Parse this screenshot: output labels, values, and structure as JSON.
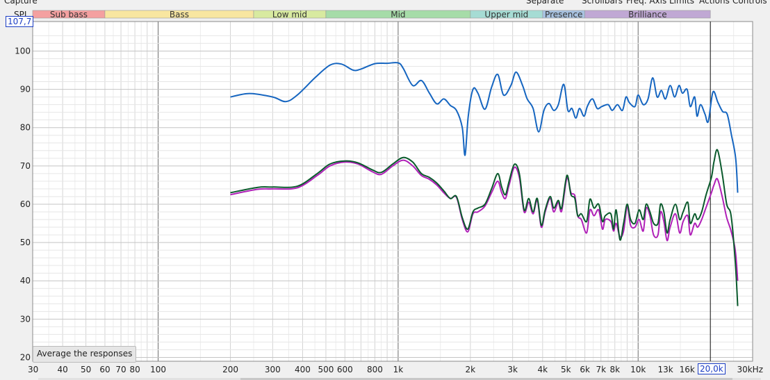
{
  "header": {
    "capture": "Capture",
    "separate": "Separate",
    "menu": [
      "Scrollbars",
      "Freq. Axis",
      "Limits",
      "Actions",
      "Controls"
    ]
  },
  "spl_label": "SPL",
  "readout_y": "107,7",
  "readout_x": "20,0k",
  "average_button": "Average the responses",
  "bands": [
    {
      "label": "Sub bass",
      "from": 30,
      "to": 60,
      "color": "#f4a0a0"
    },
    {
      "label": "Bass",
      "from": 60,
      "to": 250,
      "color": "#f8e6a0"
    },
    {
      "label": "Low mid",
      "from": 250,
      "to": 500,
      "color": "#d8eaa0"
    },
    {
      "label": "Mid",
      "from": 500,
      "to": 2000,
      "color": "#a6dca8"
    },
    {
      "label": "Upper mid",
      "from": 2000,
      "to": 4000,
      "color": "#a6dcd4"
    },
    {
      "label": "Presence",
      "from": 4000,
      "to": 6000,
      "color": "#a8c2e0"
    },
    {
      "label": "Brilliance",
      "from": 6000,
      "to": 20000,
      "color": "#c0a8d4"
    }
  ],
  "chart_data": {
    "type": "line",
    "xlabel": "",
    "ylabel": "SPL",
    "x_scale": "log",
    "xlim": [
      30,
      30000
    ],
    "ylim": [
      19,
      107.7
    ],
    "grid": true,
    "x_tick_labels": [
      {
        "v": 30,
        "t": "30"
      },
      {
        "v": 40,
        "t": "40"
      },
      {
        "v": 50,
        "t": "50"
      },
      {
        "v": 60,
        "t": "60"
      },
      {
        "v": 70,
        "t": "70"
      },
      {
        "v": 80,
        "t": "80"
      },
      {
        "v": 100,
        "t": "100"
      },
      {
        "v": 200,
        "t": "200"
      },
      {
        "v": 300,
        "t": "300"
      },
      {
        "v": 400,
        "t": "400"
      },
      {
        "v": 500,
        "t": "500"
      },
      {
        "v": 600,
        "t": "600"
      },
      {
        "v": 800,
        "t": "800"
      },
      {
        "v": 1000,
        "t": "1k"
      },
      {
        "v": 2000,
        "t": "2k"
      },
      {
        "v": 3000,
        "t": "3k"
      },
      {
        "v": 4000,
        "t": "4k"
      },
      {
        "v": 5000,
        "t": "5k"
      },
      {
        "v": 6000,
        "t": "6k"
      },
      {
        "v": 7000,
        "t": "7k"
      },
      {
        "v": 8000,
        "t": "8k"
      },
      {
        "v": 10000,
        "t": "10k"
      },
      {
        "v": 13000,
        "t": "13k"
      },
      {
        "v": 16000,
        "t": "16k"
      },
      {
        "v": 30000,
        "t": "30kHz"
      }
    ],
    "x_tick_labels_dim": [
      "13k",
      "16k"
    ],
    "y_ticks": [
      20,
      30,
      40,
      50,
      60,
      70,
      80,
      90,
      100
    ],
    "cursor_x": 20000,
    "series": [
      {
        "color": "#1565c0",
        "points": [
          [
            200,
            88
          ],
          [
            240,
            88.9
          ],
          [
            300,
            88
          ],
          [
            340,
            86.8
          ],
          [
            380,
            88.5
          ],
          [
            450,
            93
          ],
          [
            520,
            96.3
          ],
          [
            580,
            96.6
          ],
          [
            650,
            95
          ],
          [
            700,
            95.3
          ],
          [
            800,
            96.7
          ],
          [
            900,
            96.8
          ],
          [
            1000,
            96.9
          ],
          [
            1050,
            95.5
          ],
          [
            1150,
            91
          ],
          [
            1250,
            92.3
          ],
          [
            1350,
            89
          ],
          [
            1450,
            86.2
          ],
          [
            1550,
            87.5
          ],
          [
            1650,
            85.8
          ],
          [
            1750,
            84.5
          ],
          [
            1850,
            80
          ],
          [
            1900,
            72.8
          ],
          [
            1960,
            83
          ],
          [
            2050,
            90
          ],
          [
            2150,
            89
          ],
          [
            2300,
            84.8
          ],
          [
            2450,
            90.5
          ],
          [
            2600,
            93.9
          ],
          [
            2750,
            88.5
          ],
          [
            2950,
            91
          ],
          [
            3100,
            94.5
          ],
          [
            3300,
            91
          ],
          [
            3450,
            87.5
          ],
          [
            3650,
            85
          ],
          [
            3850,
            78.9
          ],
          [
            4050,
            84.5
          ],
          [
            4250,
            86.3
          ],
          [
            4450,
            84.5
          ],
          [
            4650,
            86
          ],
          [
            4900,
            91.3
          ],
          [
            5100,
            84.5
          ],
          [
            5300,
            85
          ],
          [
            5500,
            82.5
          ],
          [
            5700,
            85
          ],
          [
            5950,
            83
          ],
          [
            6150,
            85.6
          ],
          [
            6450,
            87.5
          ],
          [
            6750,
            85
          ],
          [
            7050,
            85.5
          ],
          [
            7500,
            86
          ],
          [
            7800,
            84.5
          ],
          [
            8200,
            86
          ],
          [
            8600,
            84.5
          ],
          [
            8900,
            88
          ],
          [
            9200,
            86.5
          ],
          [
            9700,
            85.5
          ],
          [
            10000,
            88.5
          ],
          [
            10500,
            86
          ],
          [
            11000,
            87.5
          ],
          [
            11500,
            93
          ],
          [
            12000,
            88
          ],
          [
            12500,
            89.7
          ],
          [
            13000,
            87.5
          ],
          [
            13600,
            91
          ],
          [
            14200,
            88
          ],
          [
            14800,
            91
          ],
          [
            15300,
            89
          ],
          [
            16000,
            90
          ],
          [
            16500,
            85.5
          ],
          [
            17200,
            88
          ],
          [
            17600,
            83
          ],
          [
            18200,
            86
          ],
          [
            19000,
            83.5
          ],
          [
            19600,
            81.6
          ],
          [
            20500,
            89.3
          ],
          [
            21500,
            86.6
          ],
          [
            22500,
            84.2
          ],
          [
            23500,
            83.5
          ],
          [
            24500,
            78
          ],
          [
            25500,
            72
          ],
          [
            26000,
            63
          ]
        ]
      },
      {
        "color": "#b020b8",
        "points": [
          [
            200,
            62.5
          ],
          [
            260,
            63.9
          ],
          [
            300,
            64
          ],
          [
            380,
            64.3
          ],
          [
            460,
            67.5
          ],
          [
            520,
            70
          ],
          [
            600,
            71
          ],
          [
            680,
            70.5
          ],
          [
            780,
            68.5
          ],
          [
            850,
            67.8
          ],
          [
            950,
            70
          ],
          [
            1050,
            71.5
          ],
          [
            1150,
            70
          ],
          [
            1250,
            67.5
          ],
          [
            1350,
            66.5
          ],
          [
            1450,
            65
          ],
          [
            1550,
            63
          ],
          [
            1650,
            61.5
          ],
          [
            1750,
            61.8
          ],
          [
            1850,
            56
          ],
          [
            1950,
            52.8
          ],
          [
            2050,
            57.5
          ],
          [
            2150,
            58
          ],
          [
            2300,
            59.5
          ],
          [
            2450,
            63
          ],
          [
            2600,
            66
          ],
          [
            2700,
            63
          ],
          [
            2800,
            61.5
          ],
          [
            2900,
            65
          ],
          [
            3050,
            69.6
          ],
          [
            3200,
            67
          ],
          [
            3350,
            58
          ],
          [
            3500,
            60.5
          ],
          [
            3650,
            57.5
          ],
          [
            3800,
            61
          ],
          [
            3950,
            54
          ],
          [
            4100,
            58
          ],
          [
            4300,
            61.5
          ],
          [
            4450,
            58
          ],
          [
            4650,
            60.5
          ],
          [
            4800,
            58.2
          ],
          [
            5050,
            66.8
          ],
          [
            5250,
            63
          ],
          [
            5450,
            62.2
          ],
          [
            5600,
            57
          ],
          [
            5800,
            56
          ],
          [
            6100,
            52.5
          ],
          [
            6300,
            58.5
          ],
          [
            6550,
            57
          ],
          [
            6850,
            58.5
          ],
          [
            7100,
            53.5
          ],
          [
            7300,
            56
          ],
          [
            7700,
            55.5
          ],
          [
            7900,
            53
          ],
          [
            8100,
            55
          ],
          [
            8400,
            51.5
          ],
          [
            8700,
            53
          ],
          [
            9000,
            59.5
          ],
          [
            9300,
            54.5
          ],
          [
            9700,
            54
          ],
          [
            10100,
            56
          ],
          [
            10500,
            53
          ],
          [
            10800,
            59
          ],
          [
            11200,
            57
          ],
          [
            11600,
            52
          ],
          [
            12100,
            52
          ],
          [
            12400,
            58
          ],
          [
            12800,
            55.5
          ],
          [
            13200,
            50.5
          ],
          [
            13600,
            54
          ],
          [
            14300,
            57.5
          ],
          [
            14900,
            52.5
          ],
          [
            15400,
            55.5
          ],
          [
            16100,
            57
          ],
          [
            16500,
            52
          ],
          [
            17200,
            55
          ],
          [
            17700,
            54
          ],
          [
            18400,
            56
          ],
          [
            19200,
            59.2
          ],
          [
            20200,
            63
          ],
          [
            20700,
            65
          ],
          [
            21400,
            66.6
          ],
          [
            22400,
            62
          ],
          [
            23400,
            56.5
          ],
          [
            24400,
            53
          ],
          [
            25400,
            48
          ],
          [
            26000,
            40
          ]
        ]
      },
      {
        "color": "#0a5a2c",
        "points": [
          [
            200,
            63
          ],
          [
            260,
            64.4
          ],
          [
            300,
            64.5
          ],
          [
            380,
            64.7
          ],
          [
            460,
            68
          ],
          [
            520,
            70.5
          ],
          [
            600,
            71.3
          ],
          [
            680,
            70.8
          ],
          [
            780,
            69
          ],
          [
            850,
            68.3
          ],
          [
            950,
            70.5
          ],
          [
            1050,
            72.2
          ],
          [
            1150,
            71
          ],
          [
            1250,
            68
          ],
          [
            1350,
            67
          ],
          [
            1450,
            65.5
          ],
          [
            1550,
            63.5
          ],
          [
            1650,
            61.5
          ],
          [
            1750,
            62
          ],
          [
            1850,
            56.5
          ],
          [
            1950,
            53.5
          ],
          [
            2050,
            58
          ],
          [
            2150,
            59
          ],
          [
            2300,
            60
          ],
          [
            2450,
            64
          ],
          [
            2600,
            68
          ],
          [
            2700,
            64.5
          ],
          [
            2800,
            62.5
          ],
          [
            2900,
            66
          ],
          [
            3050,
            70.4
          ],
          [
            3200,
            68
          ],
          [
            3350,
            58.5
          ],
          [
            3500,
            61.5
          ],
          [
            3650,
            58
          ],
          [
            3800,
            61.5
          ],
          [
            3950,
            54.5
          ],
          [
            4100,
            58.5
          ],
          [
            4300,
            62
          ],
          [
            4450,
            59
          ],
          [
            4650,
            61
          ],
          [
            4800,
            59
          ],
          [
            5050,
            67.5
          ],
          [
            5250,
            62.5
          ],
          [
            5450,
            61.5
          ],
          [
            5600,
            57
          ],
          [
            5800,
            57.5
          ],
          [
            6100,
            55.5
          ],
          [
            6300,
            61.3
          ],
          [
            6550,
            59
          ],
          [
            6850,
            60
          ],
          [
            7100,
            55.5
          ],
          [
            7300,
            57
          ],
          [
            7700,
            57.5
          ],
          [
            7900,
            53.5
          ],
          [
            8100,
            58.5
          ],
          [
            8400,
            50.7
          ],
          [
            8700,
            55
          ],
          [
            9000,
            60
          ],
          [
            9300,
            56
          ],
          [
            9700,
            55
          ],
          [
            10100,
            58.5
          ],
          [
            10500,
            56
          ],
          [
            10800,
            60
          ],
          [
            11200,
            58
          ],
          [
            11600,
            55
          ],
          [
            12100,
            55
          ],
          [
            12400,
            60
          ],
          [
            12800,
            58
          ],
          [
            13200,
            52.5
          ],
          [
            13600,
            56
          ],
          [
            14300,
            60
          ],
          [
            14900,
            56
          ],
          [
            15400,
            58
          ],
          [
            16100,
            60.5
          ],
          [
            16500,
            55
          ],
          [
            17200,
            57.5
          ],
          [
            17700,
            56
          ],
          [
            18400,
            58
          ],
          [
            19200,
            62.5
          ],
          [
            20200,
            67
          ],
          [
            20700,
            71
          ],
          [
            21400,
            74.2
          ],
          [
            22400,
            68
          ],
          [
            23400,
            60
          ],
          [
            24400,
            57
          ],
          [
            25400,
            45
          ],
          [
            26000,
            33.4
          ]
        ]
      }
    ]
  }
}
